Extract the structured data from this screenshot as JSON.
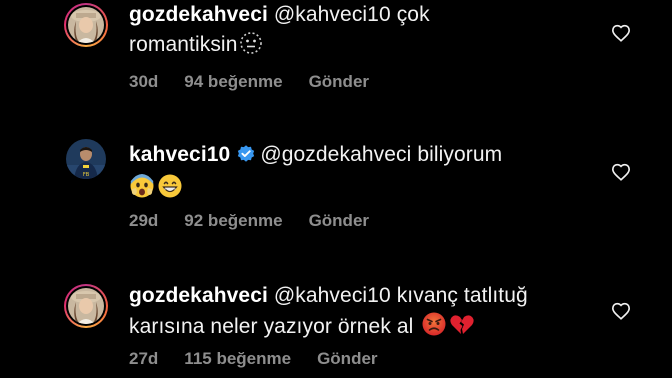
{
  "comments": [
    {
      "username": "gozdekahveci",
      "mention": "@kahveci10",
      "text_line1": "çok",
      "text_line2": "romantiksin",
      "emoji": "neutral-dotted-face-icon",
      "age": "30d",
      "likes": "94 beğenme",
      "reply": "Gönder"
    },
    {
      "username": "kahveci10",
      "verified": true,
      "mention": "@gozdekahveci",
      "text_line1": "biliyorum",
      "emoji": "fearful-face-icon, grinning-face-icon",
      "age": "29d",
      "likes": "92 beğenme",
      "reply": "Gönder"
    },
    {
      "username": "gozdekahveci",
      "mention": "@kahveci10",
      "text_line1": "kıvanç tatlıtuğ",
      "text_line2": "karısına neler yazıyor örnek al",
      "emoji": "angry-face-icon, broken-heart-icon",
      "age": "27d",
      "likes": "115 beğenme",
      "reply": "Gönder"
    }
  ],
  "colors": {
    "background": "#000000",
    "text": "#f2f2f2",
    "meta": "#8e8e8e",
    "verified": "#3897f0"
  }
}
